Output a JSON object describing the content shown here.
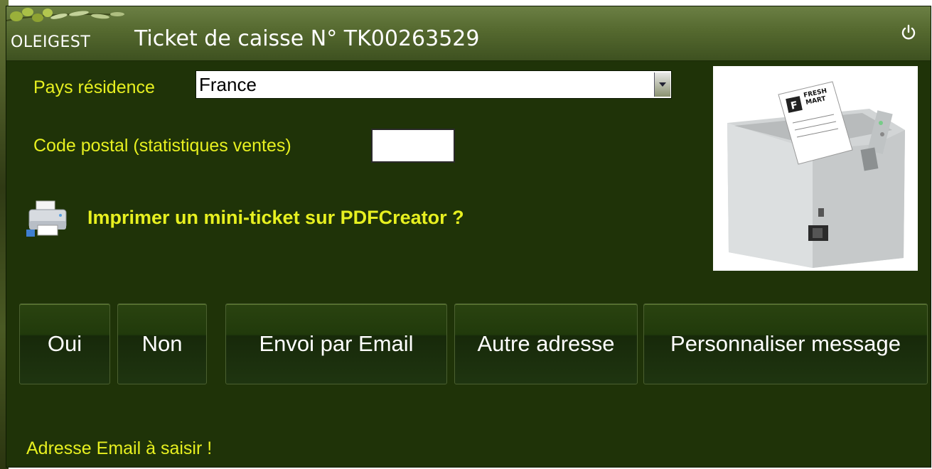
{
  "window": {
    "brand": "OLEIGEST",
    "title": "Ticket de caisse N° TK00263529"
  },
  "form": {
    "country_label": "Pays résidence",
    "country_value": "France",
    "postal_label": "Code postal (statistiques ventes)",
    "postal_value": ""
  },
  "print_option": {
    "label": "Imprimer un mini-ticket sur PDFCreator ?"
  },
  "receipt_image": {
    "brand_line1": "FRESH",
    "brand_line2": "MART"
  },
  "buttons": {
    "yes": "Oui",
    "no": "Non",
    "email": "Envoi par Email",
    "other_address": "Autre adresse",
    "customize": "Personnaliser message"
  },
  "status": "Adresse Email à saisir !",
  "colors": {
    "background": "#1f3308",
    "accent_text": "#e7f020",
    "titlebar": "#55692f"
  }
}
